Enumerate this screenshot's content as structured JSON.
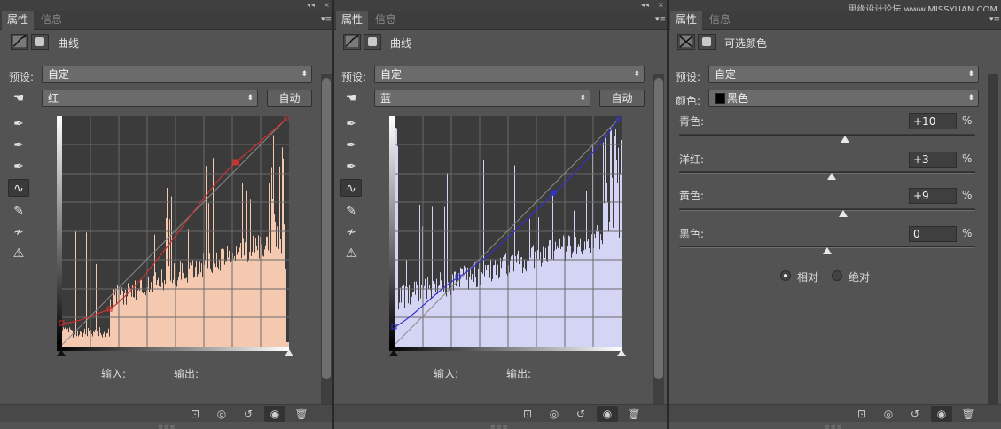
{
  "panels": [
    {
      "tab_active": "属性",
      "tab_inactive": "信息",
      "header_title": "曲线",
      "preset_label": "预设:",
      "preset_value": "自定",
      "channel_value": "红",
      "auto_label": "自动",
      "input_label": "输入:",
      "output_label": "输出:",
      "curve_color": "#c83232",
      "hist_color": "#f5c8b0"
    },
    {
      "tab_active": "属性",
      "tab_inactive": "信息",
      "header_title": "曲线",
      "preset_label": "预设:",
      "preset_value": "自定",
      "channel_value": "蓝",
      "auto_label": "自动",
      "input_label": "输入:",
      "output_label": "输出:",
      "curve_color": "#3232c8",
      "hist_color": "#d4d4f4"
    },
    {
      "tab_active": "属性",
      "tab_inactive": "信息",
      "header_title": "可选颜色",
      "watermark": "思缘设计论坛 www.MISSYUAN.COM",
      "preset_label": "预设:",
      "preset_value": "自定",
      "color_label": "颜色:",
      "color_value": "黑色",
      "adjustments": [
        {
          "label": "青色:",
          "value": "+10",
          "unit": "%",
          "position": 0.56
        },
        {
          "label": "洋红:",
          "value": "+3",
          "unit": "%",
          "position": 0.515
        },
        {
          "label": "黄色:",
          "value": "+9",
          "unit": "%",
          "position": 0.554
        },
        {
          "label": "黑色:",
          "value": "0",
          "unit": "%",
          "position": 0.5
        }
      ],
      "mode_relative": "相对",
      "mode_absolute": "绝对"
    }
  ],
  "colors": {
    "panel_bg": "#535353",
    "tab_bar": "#3d3d3d",
    "field_bg": "#6b6b6b"
  }
}
